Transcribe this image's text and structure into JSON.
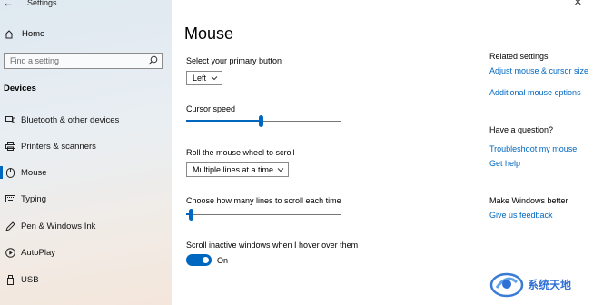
{
  "window": {
    "title": "Settings",
    "back_glyph": "←",
    "close_glyph": "✕"
  },
  "sidebar": {
    "home_label": "Home",
    "search_placeholder": "Find a setting",
    "section_label": "Devices",
    "items": [
      {
        "label": "Bluetooth & other devices",
        "icon": "bluetooth-device-icon",
        "selected": false
      },
      {
        "label": "Printers & scanners",
        "icon": "printer-icon",
        "selected": false
      },
      {
        "label": "Mouse",
        "icon": "mouse-icon",
        "selected": true
      },
      {
        "label": "Typing",
        "icon": "keyboard-icon",
        "selected": false
      },
      {
        "label": "Pen & Windows Ink",
        "icon": "pen-icon",
        "selected": false
      },
      {
        "label": "AutoPlay",
        "icon": "autoplay-icon",
        "selected": false
      },
      {
        "label": "USB",
        "icon": "usb-icon",
        "selected": false
      }
    ]
  },
  "main": {
    "title": "Mouse",
    "primary_button": {
      "label": "Select your primary button",
      "value": "Left"
    },
    "cursor_speed": {
      "label": "Cursor speed",
      "value_fraction": 0.48
    },
    "scroll_wheel": {
      "label": "Roll the mouse wheel to scroll",
      "value": "Multiple lines at a time"
    },
    "lines_to_scroll": {
      "label": "Choose how many lines to scroll each time",
      "value_fraction": 0.03
    },
    "inactive_scroll": {
      "label": "Scroll inactive windows when I hover over them",
      "state": "On",
      "enabled": true
    }
  },
  "related": {
    "heading": "Related settings",
    "links": [
      "Adjust mouse & cursor size",
      "Additional mouse options"
    ]
  },
  "question": {
    "heading": "Have a question?",
    "links": [
      "Troubleshoot my mouse",
      "Get help"
    ]
  },
  "better": {
    "heading": "Make Windows better",
    "links": [
      "Give us feedback"
    ]
  },
  "watermark": {
    "text": "系统天地"
  },
  "colors": {
    "accent": "#0067c0",
    "sidebar_top": "#dfe9f1",
    "sidebar_bottom": "#f4e6db"
  }
}
